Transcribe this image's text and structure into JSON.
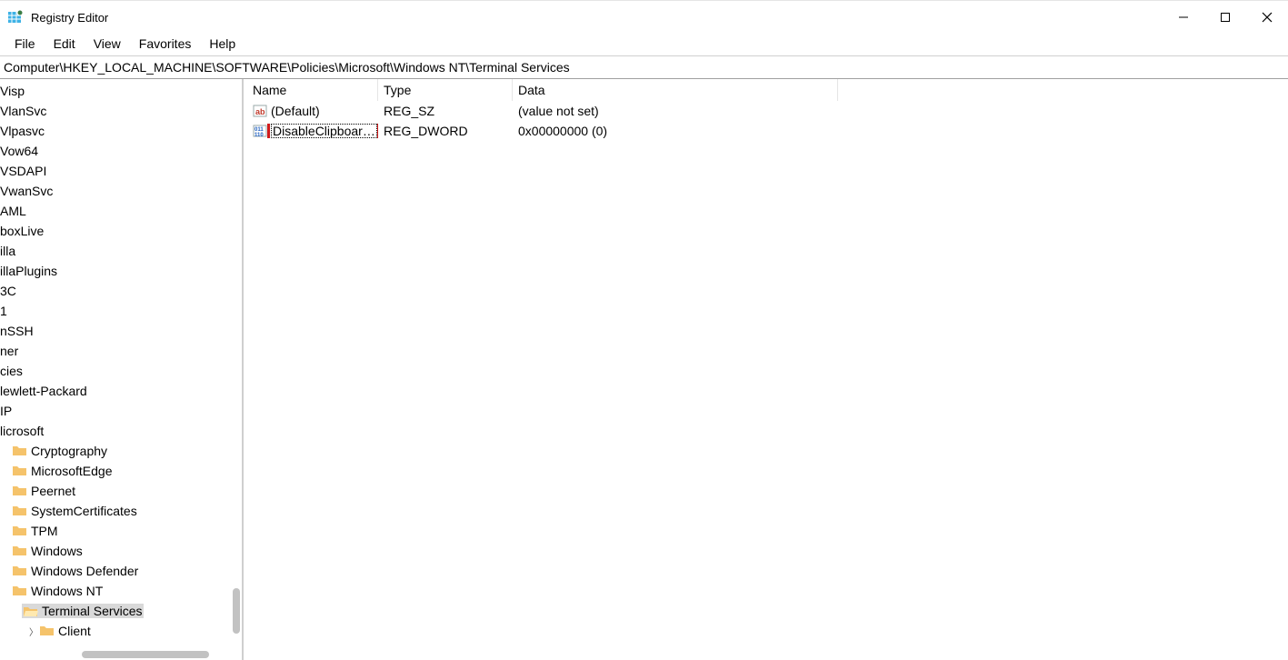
{
  "window": {
    "title": "Registry Editor"
  },
  "menu": {
    "file": "File",
    "edit": "Edit",
    "view": "View",
    "favorites": "Favorites",
    "help": "Help"
  },
  "address": "Computer\\HKEY_LOCAL_MACHINE\\SOFTWARE\\Policies\\Microsoft\\Windows NT\\Terminal Services",
  "tree": {
    "items": [
      {
        "label": "Visp",
        "indent": 0,
        "folder": false
      },
      {
        "label": "VlanSvc",
        "indent": 0,
        "folder": false
      },
      {
        "label": "Vlpasvc",
        "indent": 0,
        "folder": false
      },
      {
        "label": "Vow64",
        "indent": 0,
        "folder": false
      },
      {
        "label": "VSDAPI",
        "indent": 0,
        "folder": false
      },
      {
        "label": "VwanSvc",
        "indent": 0,
        "folder": false
      },
      {
        "label": "AML",
        "indent": 0,
        "folder": false
      },
      {
        "label": "boxLive",
        "indent": 0,
        "folder": false
      },
      {
        "label": "illa",
        "indent": 0,
        "folder": false
      },
      {
        "label": "illaPlugins",
        "indent": 0,
        "folder": false
      },
      {
        "label": "3C",
        "indent": 0,
        "folder": false
      },
      {
        "label": "1",
        "indent": 0,
        "folder": false
      },
      {
        "label": "nSSH",
        "indent": 0,
        "folder": false
      },
      {
        "label": "ner",
        "indent": 0,
        "folder": false
      },
      {
        "label": "cies",
        "indent": 0,
        "folder": false
      },
      {
        "label": "lewlett-Packard",
        "indent": 0,
        "folder": false
      },
      {
        "label": "IP",
        "indent": 0,
        "folder": false
      },
      {
        "label": "licrosoft",
        "indent": 0,
        "folder": false
      },
      {
        "label": "Cryptography",
        "indent": 1,
        "folder": true
      },
      {
        "label": "MicrosoftEdge",
        "indent": 1,
        "folder": true
      },
      {
        "label": "Peernet",
        "indent": 1,
        "folder": true
      },
      {
        "label": "SystemCertificates",
        "indent": 1,
        "folder": true
      },
      {
        "label": "TPM",
        "indent": 1,
        "folder": true
      },
      {
        "label": "Windows",
        "indent": 1,
        "folder": true
      },
      {
        "label": "Windows Defender",
        "indent": 1,
        "folder": true
      },
      {
        "label": "Windows NT",
        "indent": 1,
        "folder": true
      },
      {
        "label": "Terminal Services",
        "indent": 2,
        "folder": true,
        "open": true,
        "selected": true
      },
      {
        "label": "Client",
        "indent": 3,
        "folder": true,
        "chev": true
      }
    ]
  },
  "list": {
    "headers": {
      "name": "Name",
      "type": "Type",
      "data": "Data"
    },
    "rows": [
      {
        "name": "(Default)",
        "type": "REG_SZ",
        "data": "(value not set)",
        "kind": "sz"
      },
      {
        "name": "DisableClipboar…",
        "type": "REG_DWORD",
        "data": "0x00000000 (0)",
        "kind": "dword",
        "highlight": true
      }
    ]
  }
}
